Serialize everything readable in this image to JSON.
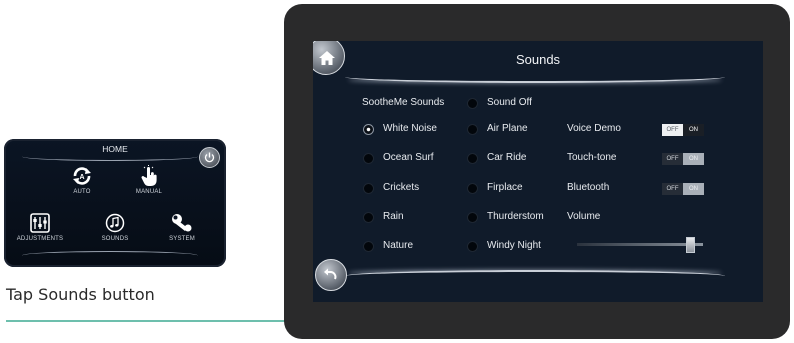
{
  "home_panel": {
    "title": "HOME",
    "items": [
      {
        "label": "AUTO",
        "icon": "auto-cycle-icon"
      },
      {
        "label": "MANUAL",
        "icon": "hand-touch-icon"
      },
      {
        "label": "ADJUSTMENTS",
        "icon": "sliders-icon"
      },
      {
        "label": "SOUNDS",
        "icon": "music-note-icon"
      },
      {
        "label": "SYSTEM",
        "icon": "wrench-icon"
      }
    ]
  },
  "caption": "Tap Sounds button",
  "accent_color": "#6dbfad",
  "sounds_screen": {
    "title": "Sounds",
    "section_label": "SootheMe Sounds",
    "sounds_col1": [
      "White Noise",
      "Ocean Surf",
      "Crickets",
      "Rain",
      "Nature"
    ],
    "sounds_col2": [
      "Sound Off",
      "Air Plane",
      "Car Ride",
      "Firplace",
      "Thurderstom",
      "Windy Night"
    ],
    "selected_sound": "White Noise",
    "settings": [
      {
        "label": "Voice Demo",
        "state": "on"
      },
      {
        "label": "Touch-tone",
        "state": "off"
      },
      {
        "label": "Bluetooth",
        "state": "off"
      }
    ],
    "toggle_off_text": "OFF",
    "toggle_on_text": "ON",
    "volume_label": "Volume",
    "volume_level": 0.9
  }
}
